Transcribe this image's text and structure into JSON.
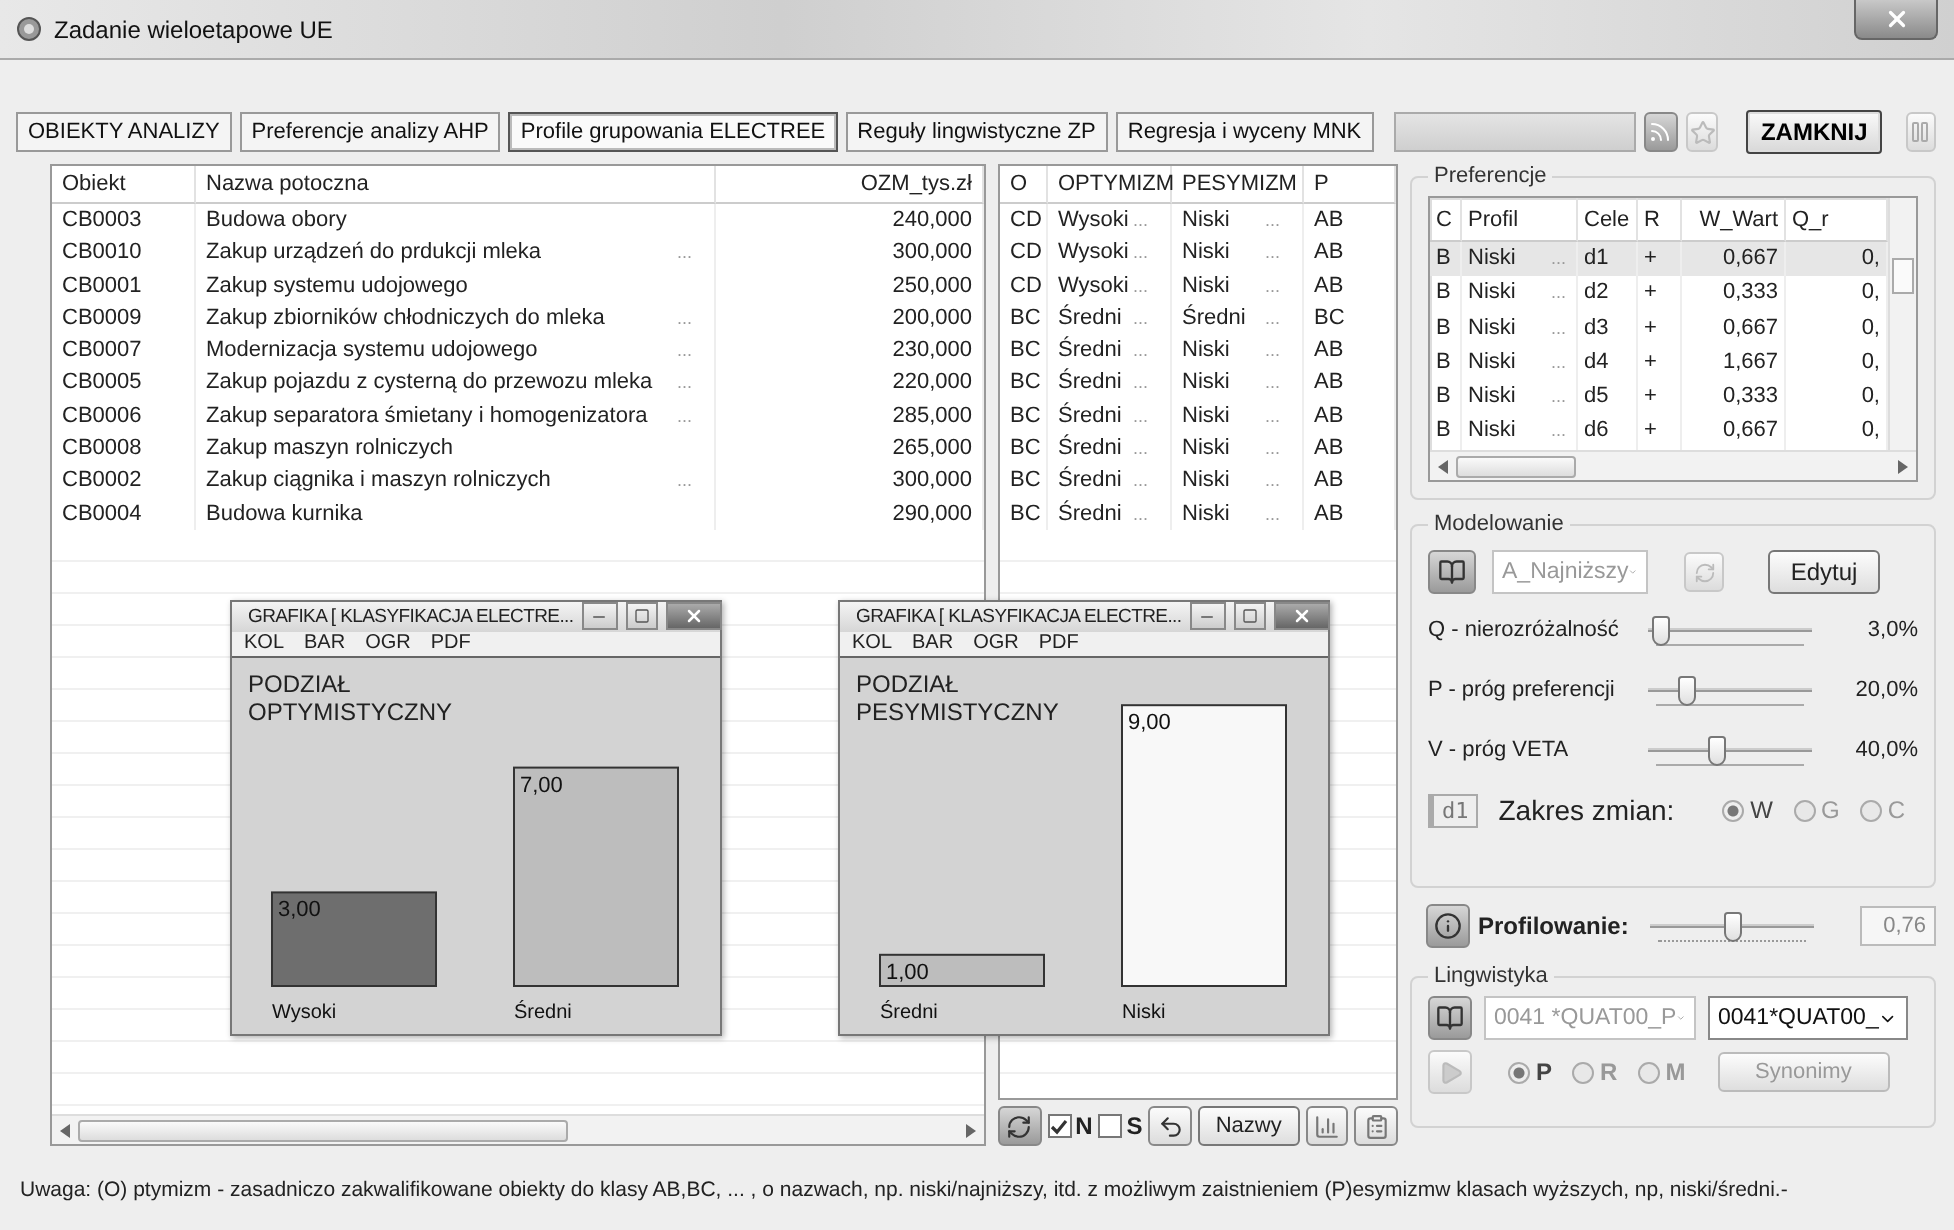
{
  "window": {
    "title": "Zadanie wieloetapowe UE"
  },
  "tabs": [
    {
      "label": "OBIEKTY ANALIZY",
      "selected": false
    },
    {
      "label": "Preferencje analizy AHP",
      "selected": false
    },
    {
      "label": "Profile grupowania ELECTREE",
      "selected": true
    },
    {
      "label": "Reguły lingwistyczne  ZP",
      "selected": false
    },
    {
      "label": "Regresja i wyceny  MNK",
      "selected": false
    }
  ],
  "toolbar": {
    "close_button": "ZAMKNIJ"
  },
  "objects_table": {
    "columns": [
      "Obiekt",
      "Nazwa potoczna",
      "OZM_tys.zł"
    ],
    "rows": [
      {
        "code": "CB0003",
        "name": "Budowa obory",
        "value": "240,000"
      },
      {
        "code": "CB0010",
        "name": "Zakup urządzeń do prdukcji mleka",
        "more": "...",
        "value": "300,000"
      },
      {
        "code": "CB0001",
        "name": "Zakup systemu udojowego",
        "value": "250,000"
      },
      {
        "code": "CB0009",
        "name": "Zakup zbiorników chłodniczych do mleka",
        "more": "...",
        "value": "200,000"
      },
      {
        "code": "CB0007",
        "name": "Modernizacja systemu udojowego",
        "more": "...",
        "value": "230,000"
      },
      {
        "code": "CB0005",
        "name": "Zakup pojazdu z cysterną do przewozu mleka",
        "more": "...",
        "value": "220,000"
      },
      {
        "code": "CB0006",
        "name": "Zakup separatora śmietany i homogenizatora",
        "more": "...",
        "value": "285,000"
      },
      {
        "code": "CB0008",
        "name": "Zakup maszyn rolniczych",
        "value": "265,000"
      },
      {
        "code": "CB0002",
        "name": "Zakup ciągnika i maszyn rolniczych",
        "more": "...",
        "value": "300,000"
      },
      {
        "code": "CB0004",
        "name": "Budowa kurnika",
        "value": "290,000"
      }
    ]
  },
  "classification_table": {
    "columns": [
      "O",
      "OPTYMIZM",
      "PESYMIZM",
      "P"
    ],
    "rows": [
      {
        "o": "CD",
        "optimism": "Wysoki",
        "optimism_more": "...",
        "pessimism": "Niski",
        "pessimism_more": "...",
        "p": "AB"
      },
      {
        "o": "CD",
        "optimism": "Wysoki",
        "optimism_more": "...",
        "pessimism": "Niski",
        "pessimism_more": "...",
        "p": "AB"
      },
      {
        "o": "CD",
        "optimism": "Wysoki",
        "optimism_more": "...",
        "pessimism": "Niski",
        "pessimism_more": "...",
        "p": "AB"
      },
      {
        "o": "BC",
        "optimism": "Średni",
        "optimism_more": "...",
        "pessimism": "Średni",
        "pessimism_more": "...",
        "p": "BC"
      },
      {
        "o": "BC",
        "optimism": "Średni",
        "optimism_more": "...",
        "pessimism": "Niski",
        "pessimism_more": "...",
        "p": "AB"
      },
      {
        "o": "BC",
        "optimism": "Średni",
        "optimism_more": "...",
        "pessimism": "Niski",
        "pessimism_more": "...",
        "p": "AB"
      },
      {
        "o": "BC",
        "optimism": "Średni",
        "optimism_more": "...",
        "pessimism": "Niski",
        "pessimism_more": "...",
        "p": "AB"
      },
      {
        "o": "BC",
        "optimism": "Średni",
        "optimism_more": "...",
        "pessimism": "Niski",
        "pessimism_more": "...",
        "p": "AB"
      },
      {
        "o": "BC",
        "optimism": "Średni",
        "optimism_more": "...",
        "pessimism": "Niski",
        "pessimism_more": "...",
        "p": "AB"
      },
      {
        "o": "BC",
        "optimism": "Średni",
        "optimism_more": "...",
        "pessimism": "Niski",
        "pessimism_more": "...",
        "p": "AB"
      }
    ]
  },
  "classification_toolbar": {
    "checkboxes": [
      {
        "label": "N",
        "checked": true
      },
      {
        "label": "S",
        "checked": false
      }
    ],
    "names_button": "Nazwy"
  },
  "preferences": {
    "title": "Preferencje",
    "columns": [
      "C",
      "Profil",
      "Cele",
      "R",
      "W_Wart",
      "Q_r"
    ],
    "rows": [
      {
        "c": "B",
        "profile": "Niski",
        "more": "...",
        "goal": "d1",
        "r": "+",
        "w": "0,667",
        "q": "0,",
        "selected": true
      },
      {
        "c": "B",
        "profile": "Niski",
        "more": "...",
        "goal": "d2",
        "r": "+",
        "w": "0,333",
        "q": "0,",
        "selected": false
      },
      {
        "c": "B",
        "profile": "Niski",
        "more": "...",
        "goal": "d3",
        "r": "+",
        "w": "0,667",
        "q": "0,",
        "selected": false
      },
      {
        "c": "B",
        "profile": "Niski",
        "more": "...",
        "goal": "d4",
        "r": "+",
        "w": "1,667",
        "q": "0,",
        "selected": false
      },
      {
        "c": "B",
        "profile": "Niski",
        "more": "...",
        "goal": "d5",
        "r": "+",
        "w": "0,333",
        "q": "0,",
        "selected": false
      },
      {
        "c": "B",
        "profile": "Niski",
        "more": "...",
        "goal": "d6",
        "r": "+",
        "w": "0,667",
        "q": "0,",
        "selected": false
      }
    ]
  },
  "modeling": {
    "title": "Modelowanie",
    "profile_select": {
      "value": "A_Najniższy",
      "disabled": true
    },
    "edit_button": "Edytuj",
    "sliders": [
      {
        "label": "Q - nierozróżalność",
        "level": 0.03,
        "reading": "3,0%"
      },
      {
        "label": "P - próg preferencji",
        "level": 0.2,
        "reading": "20,0%"
      },
      {
        "label": "V - próg VETA",
        "level": 0.4,
        "reading": "40,0%"
      }
    ],
    "range": {
      "badge": "d1",
      "label": "Zakres zmian:",
      "options": [
        {
          "label": "W",
          "selected": true
        },
        {
          "label": "G",
          "selected": false
        },
        {
          "label": "C",
          "selected": false
        }
      ]
    }
  },
  "profiling": {
    "label": "Profilowanie:",
    "level": 0.5,
    "value": "0,76"
  },
  "linguistics": {
    "title": "Lingwistyka",
    "select_primary": {
      "value": "0041 *QUAT00_P",
      "disabled": true
    },
    "select_secondary": {
      "value": "0041*QUAT00_",
      "disabled": false
    },
    "options": [
      {
        "label": "P",
        "selected": true
      },
      {
        "label": "R",
        "selected": false
      },
      {
        "label": "M",
        "selected": false
      }
    ],
    "synonyms_button": {
      "label": "Synonimy",
      "disabled": true
    }
  },
  "chart_windows": [
    {
      "title": "GRAFIKA [ KLASYFIKACJA ELECTRE...",
      "menu": [
        "KOL",
        "BAR",
        "OGR",
        "PDF"
      ],
      "chart_data": {
        "type": "bar",
        "title": "PODZIAŁ OPTYMISTYCZNY",
        "data_labels": true,
        "series": [
          {
            "name": "Wysoki",
            "color": "#6e6e6e",
            "values": [
              3
            ],
            "value_labels": [
              "3,00"
            ]
          },
          {
            "name": "Średni",
            "color": "#bdbdbd",
            "values": [
              7
            ],
            "value_labels": [
              "7,00"
            ]
          }
        ]
      }
    },
    {
      "title": "GRAFIKA [ KLASYFIKACJA ELECTRE...",
      "menu": [
        "KOL",
        "BAR",
        "OGR",
        "PDF"
      ],
      "chart_data": {
        "type": "bar",
        "title": "PODZIAŁ PESYMISTYCZNY",
        "data_labels": true,
        "series": [
          {
            "name": "Średni",
            "color": "#bdbdbd",
            "values": [
              1
            ],
            "value_labels": [
              "1,00"
            ]
          },
          {
            "name": "Niski",
            "color": "#f8f8f8",
            "values": [
              9
            ],
            "value_labels": [
              "9,00"
            ]
          }
        ]
      }
    }
  ],
  "note": "Uwaga: (O) ptymizm  -  zasadniczo zakwalifikowane obiekty do klasy AB,BC, ... , o nazwach, np. niski/najniższy, itd. z możliwym zaistnieniem (P)esymizmw klasach wyższych, np, niski/średni.-"
}
